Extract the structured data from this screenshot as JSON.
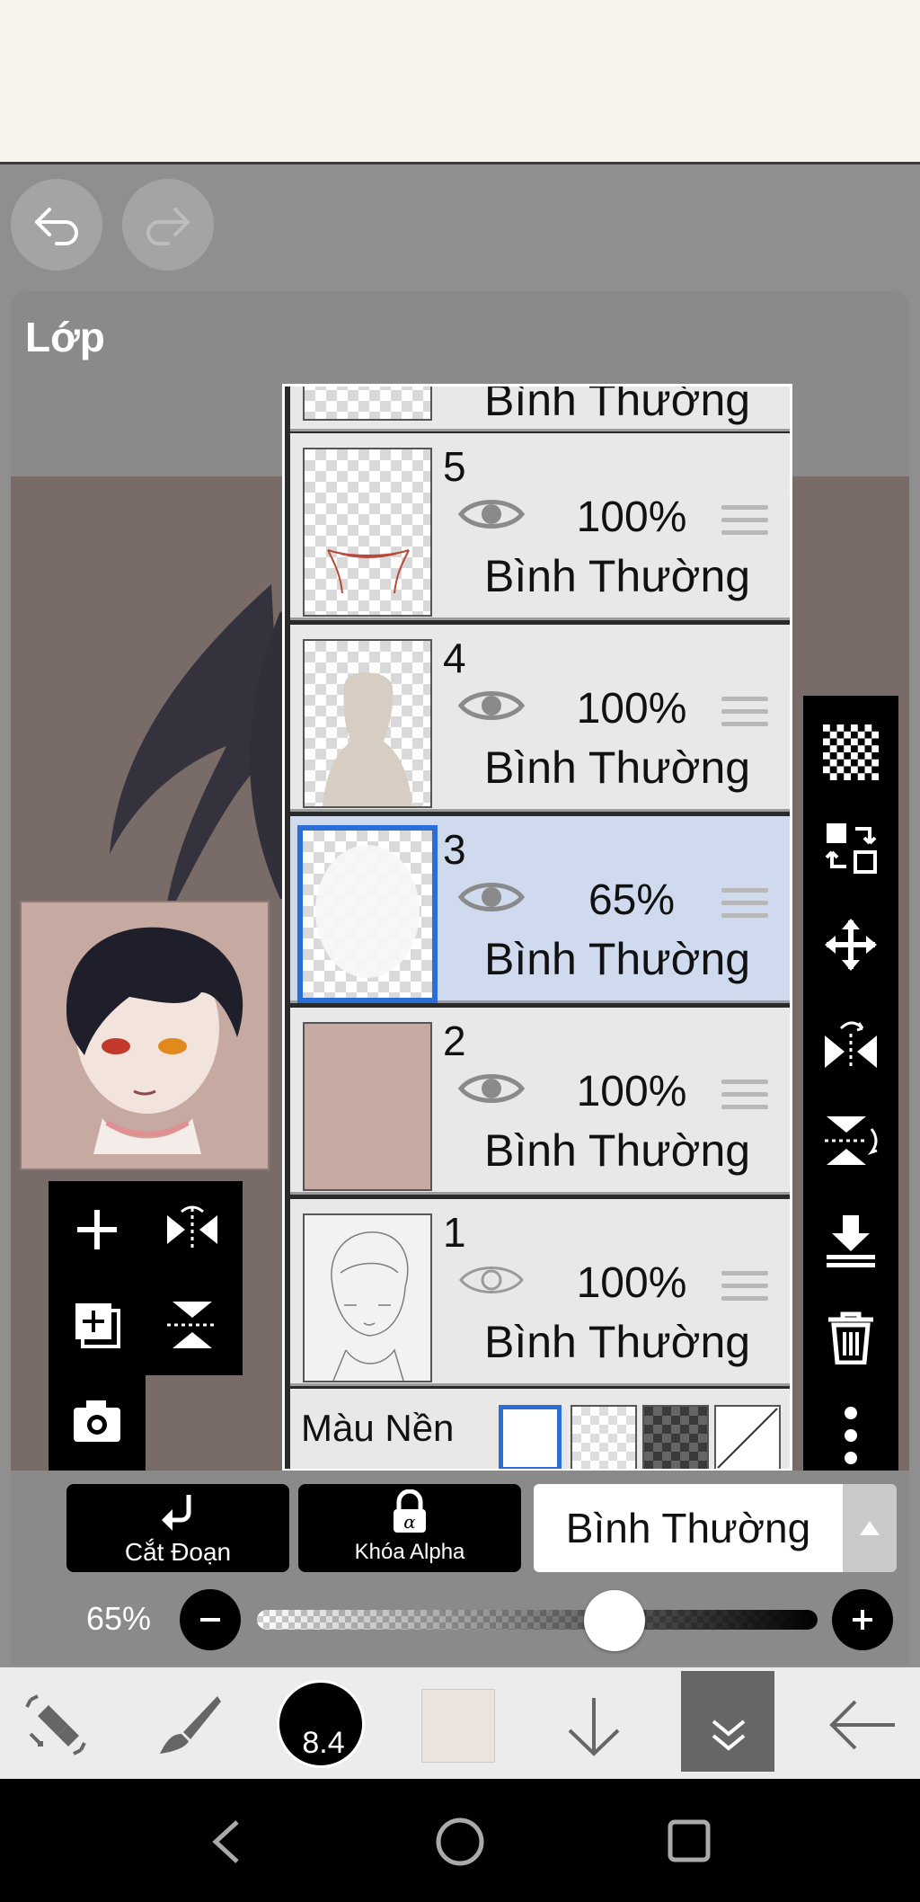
{
  "panel": {
    "title": "Lớp"
  },
  "layers": [
    {
      "num": "5",
      "opacity": "100%",
      "blend": "Bình Thường",
      "selected": false
    },
    {
      "num": "4",
      "opacity": "100%",
      "blend": "Bình Thường",
      "selected": false
    },
    {
      "num": "3",
      "opacity": "65%",
      "blend": "Bình Thường",
      "selected": true
    },
    {
      "num": "2",
      "opacity": "100%",
      "blend": "Bình Thường",
      "selected": false
    },
    {
      "num": "1",
      "opacity": "100%",
      "blend": "Bình Thường",
      "selected": false
    }
  ],
  "partial_layer": {
    "blend": "Bình Thường"
  },
  "background_row": {
    "label": "Màu Nền"
  },
  "actions": {
    "clip_label": "Cắt Đoạn",
    "alpha_lock_label": "Khóa Alpha",
    "blend_mode": "Bình Thường"
  },
  "opacity_slider": {
    "label": "65%",
    "value": 0.65
  },
  "toolbar": {
    "brush_size": "8.4",
    "color": "#ede3de"
  },
  "colors": {
    "selected_layer": "#cfdaee",
    "accent": "#2a6fd6",
    "layer2_fill": "#c6aaa2"
  }
}
